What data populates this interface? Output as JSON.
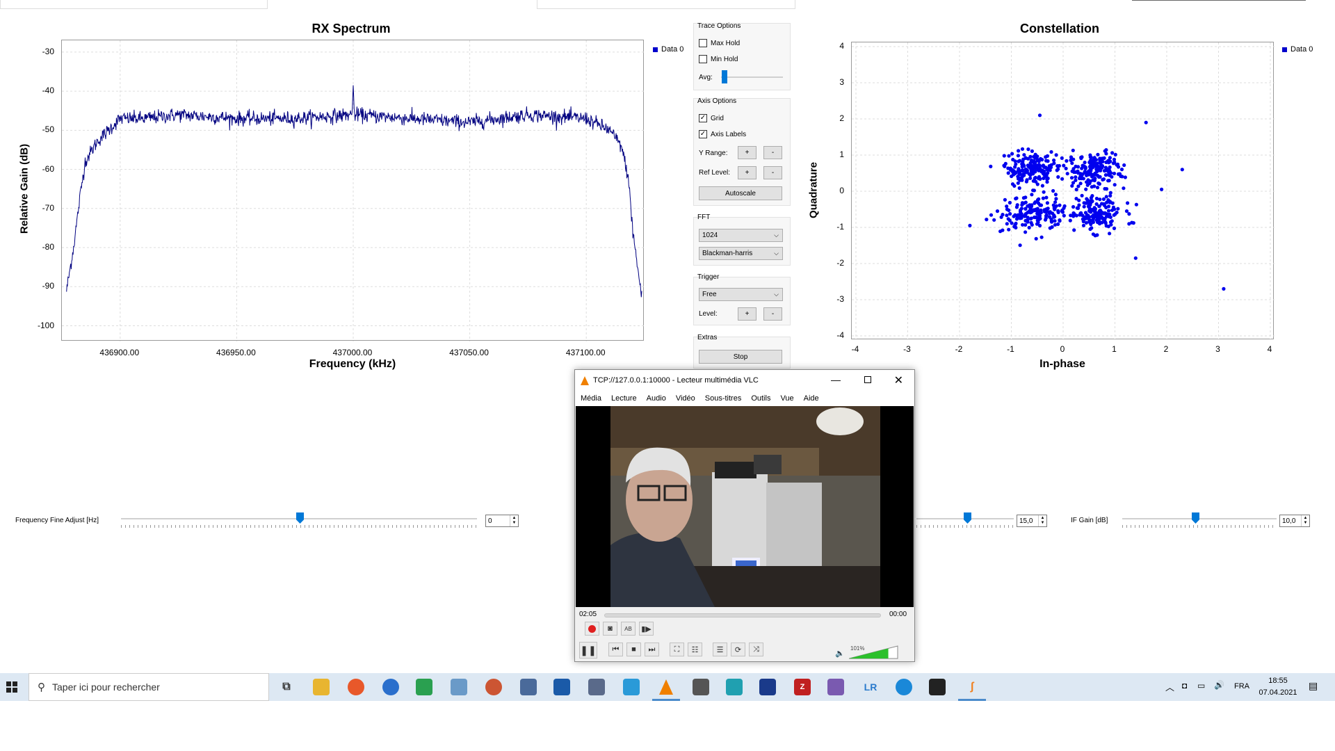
{
  "spectrum": {
    "title": "RX Spectrum",
    "xlabel": "Frequency (kHz)",
    "ylabel": "Relative Gain (dB)",
    "legend": "Data 0",
    "yticks": [
      "-30",
      "-40",
      "-50",
      "-60",
      "-70",
      "-80",
      "-90",
      "-100"
    ],
    "xticks": [
      "436900.00",
      "436950.00",
      "437000.00",
      "437050.00",
      "437100.00"
    ]
  },
  "constellation": {
    "title": "Constellation",
    "xlabel": "In-phase",
    "ylabel": "Quadrature",
    "legend": "Data 0",
    "yticks": [
      "4",
      "3",
      "2",
      "1",
      "0",
      "-1",
      "-2",
      "-3",
      "-4"
    ],
    "xticks": [
      "-4",
      "-3",
      "-2",
      "-1",
      "0",
      "1",
      "2",
      "3",
      "4"
    ]
  },
  "controls": {
    "trace_options": {
      "title": "Trace Options",
      "max_hold": "Max Hold",
      "min_hold": "Min Hold",
      "avg": "Avg:"
    },
    "axis_options": {
      "title": "Axis Options",
      "grid": "Grid",
      "axis_labels": "Axis Labels",
      "y_range": "Y Range:",
      "ref_level": "Ref Level:",
      "plus": "+",
      "minus": "-",
      "autoscale": "Autoscale"
    },
    "fft": {
      "title": "FFT",
      "size": "1024",
      "window": "Blackman-harris"
    },
    "trigger": {
      "title": "Trigger",
      "mode": "Free",
      "level": "Level:"
    },
    "extras": {
      "title": "Extras",
      "stop": "Stop"
    }
  },
  "sliders": {
    "freq_fine_label": "Frequency Fine Adjust [Hz]",
    "freq_fine_value": "0",
    "rf_gain_value": "15,0",
    "if_gain_label": "IF Gain [dB]",
    "if_gain_value": "10,0"
  },
  "vlc": {
    "title": "TCP://127.0.0.1:10000 - Lecteur multimédia VLC",
    "menu": [
      "Média",
      "Lecture",
      "Audio",
      "Vidéo",
      "Sous-titres",
      "Outils",
      "Vue",
      "Aide"
    ],
    "time_elapsed": "02:05",
    "time_total": "00:00",
    "volume": "101%",
    "volume_level": 1.01
  },
  "taskbar": {
    "search_placeholder": "Taper ici pour rechercher",
    "language": "FRA",
    "time": "18:55",
    "date": "07.04.2021"
  },
  "colors": {
    "trace": "#000080",
    "constellation_points": "#0000ee",
    "accent": "#0078d7",
    "record": "#e02020"
  },
  "chart_data": [
    {
      "type": "line",
      "title": "RX Spectrum",
      "xlabel": "Frequency (kHz)",
      "ylabel": "Relative Gain (dB)",
      "xlim": [
        436875,
        437125
      ],
      "ylim": [
        -104,
        -27
      ],
      "grid": true,
      "legend_position": "top-right",
      "series": [
        {
          "name": "Data 0",
          "x": [
            436877,
            436880,
            436883,
            436885,
            436890,
            436895,
            436900,
            436910,
            436925,
            436950,
            436975,
            436999.5,
            437000,
            437000.5,
            437025,
            437050,
            437075,
            437100,
            437110,
            437115,
            437118,
            437120,
            437122,
            437124
          ],
          "y": [
            -91,
            -80,
            -66,
            -58,
            -53,
            -50,
            -47,
            -47,
            -46,
            -47,
            -47,
            -46,
            -38.5,
            -46,
            -47,
            -48,
            -46,
            -47,
            -50,
            -54,
            -62,
            -76,
            -85,
            -93.5
          ]
        }
      ]
    },
    {
      "type": "scatter",
      "title": "Constellation",
      "xlabel": "In-phase",
      "ylabel": "Quadrature",
      "xlim": [
        -4,
        4
      ],
      "ylim": [
        -4,
        4
      ],
      "grid": true,
      "legend_position": "top-right",
      "series": [
        {
          "name": "Data 0",
          "clusters": [
            {
              "center": [
                -0.6,
                0.6
              ],
              "spread": 0.28
            },
            {
              "center": [
                0.6,
                0.6
              ],
              "spread": 0.28
            },
            {
              "center": [
                -0.6,
                -0.6
              ],
              "spread": 0.28
            },
            {
              "center": [
                0.6,
                -0.6
              ],
              "spread": 0.28
            }
          ],
          "outliers": [
            [
              -0.45,
              2.1
            ],
            [
              1.6,
              1.9
            ],
            [
              2.3,
              0.6
            ],
            [
              1.9,
              0.05
            ],
            [
              -1.8,
              -0.95
            ],
            [
              1.4,
              -1.85
            ],
            [
              3.1,
              -2.7
            ]
          ]
        }
      ]
    }
  ]
}
